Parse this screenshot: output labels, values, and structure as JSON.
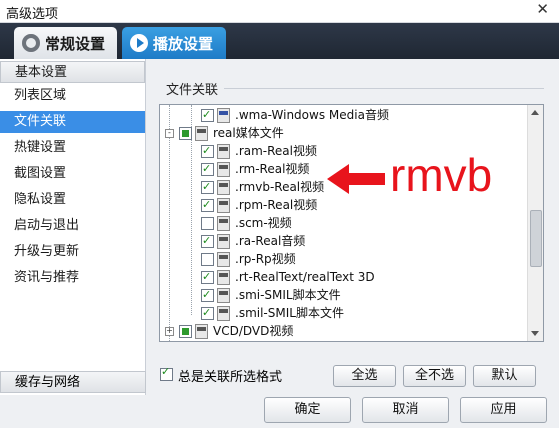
{
  "window": {
    "title": "高级选项",
    "close_glyph": "✕"
  },
  "tabs": [
    {
      "label": "常规设置",
      "icon": "gear-icon"
    },
    {
      "label": "播放设置",
      "icon": "play-icon"
    }
  ],
  "sidebar": {
    "header": "基本设置",
    "items": [
      "列表区域",
      "文件关联",
      "热键设置",
      "截图设置",
      "隐私设置",
      "启动与退出",
      "升级与更新",
      "资讯与推荐"
    ],
    "selected": "文件关联",
    "footer": "缓存与网络"
  },
  "content": {
    "group_title": "文件关联",
    "tree": [
      {
        "label": ".wma-Windows Media音频",
        "checked": true,
        "level": 2,
        "icon": "wmv-file-icon"
      },
      {
        "label": "real媒体文件",
        "checked": "partial",
        "level": 1,
        "icon": "real-file-icon",
        "expand": "-"
      },
      {
        "label": ".ram-Real视频",
        "checked": true,
        "level": 2,
        "icon": "real-file-icon"
      },
      {
        "label": ".rm-Real视频",
        "checked": true,
        "level": 2,
        "icon": "real-file-icon"
      },
      {
        "label": ".rmvb-Real视频",
        "checked": true,
        "level": 2,
        "icon": "real-file-icon"
      },
      {
        "label": ".rpm-Real视频",
        "checked": true,
        "level": 2,
        "icon": "real-file-icon"
      },
      {
        "label": ".scm-视频",
        "checked": false,
        "level": 2,
        "icon": "real-file-icon"
      },
      {
        "label": ".ra-Real音频",
        "checked": true,
        "level": 2,
        "icon": "real-file-icon"
      },
      {
        "label": ".rp-Rp视频",
        "checked": false,
        "level": 2,
        "icon": "real-file-icon"
      },
      {
        "label": ".rt-RealText/realText 3D",
        "checked": true,
        "level": 2,
        "icon": "real-file-icon"
      },
      {
        "label": ".smi-SMIL脚本文件",
        "checked": true,
        "level": 2,
        "icon": "real-file-icon"
      },
      {
        "label": ".smil-SMIL脚本文件",
        "checked": true,
        "level": 2,
        "icon": "real-file-icon"
      },
      {
        "label": "VCD/DVD视频",
        "checked": "partial",
        "level": 1,
        "icon": "dvd-file-icon",
        "expand": "+"
      }
    ],
    "always_associate": {
      "label": "总是关联所选格式",
      "checked": true
    },
    "buttons": {
      "select_all": "全选",
      "select_none": "全不选",
      "default": "默认"
    }
  },
  "footer": {
    "ok": "确定",
    "cancel": "取消",
    "apply": "应用"
  },
  "annotation": {
    "text": "rmvb",
    "color": "#e8141c"
  }
}
